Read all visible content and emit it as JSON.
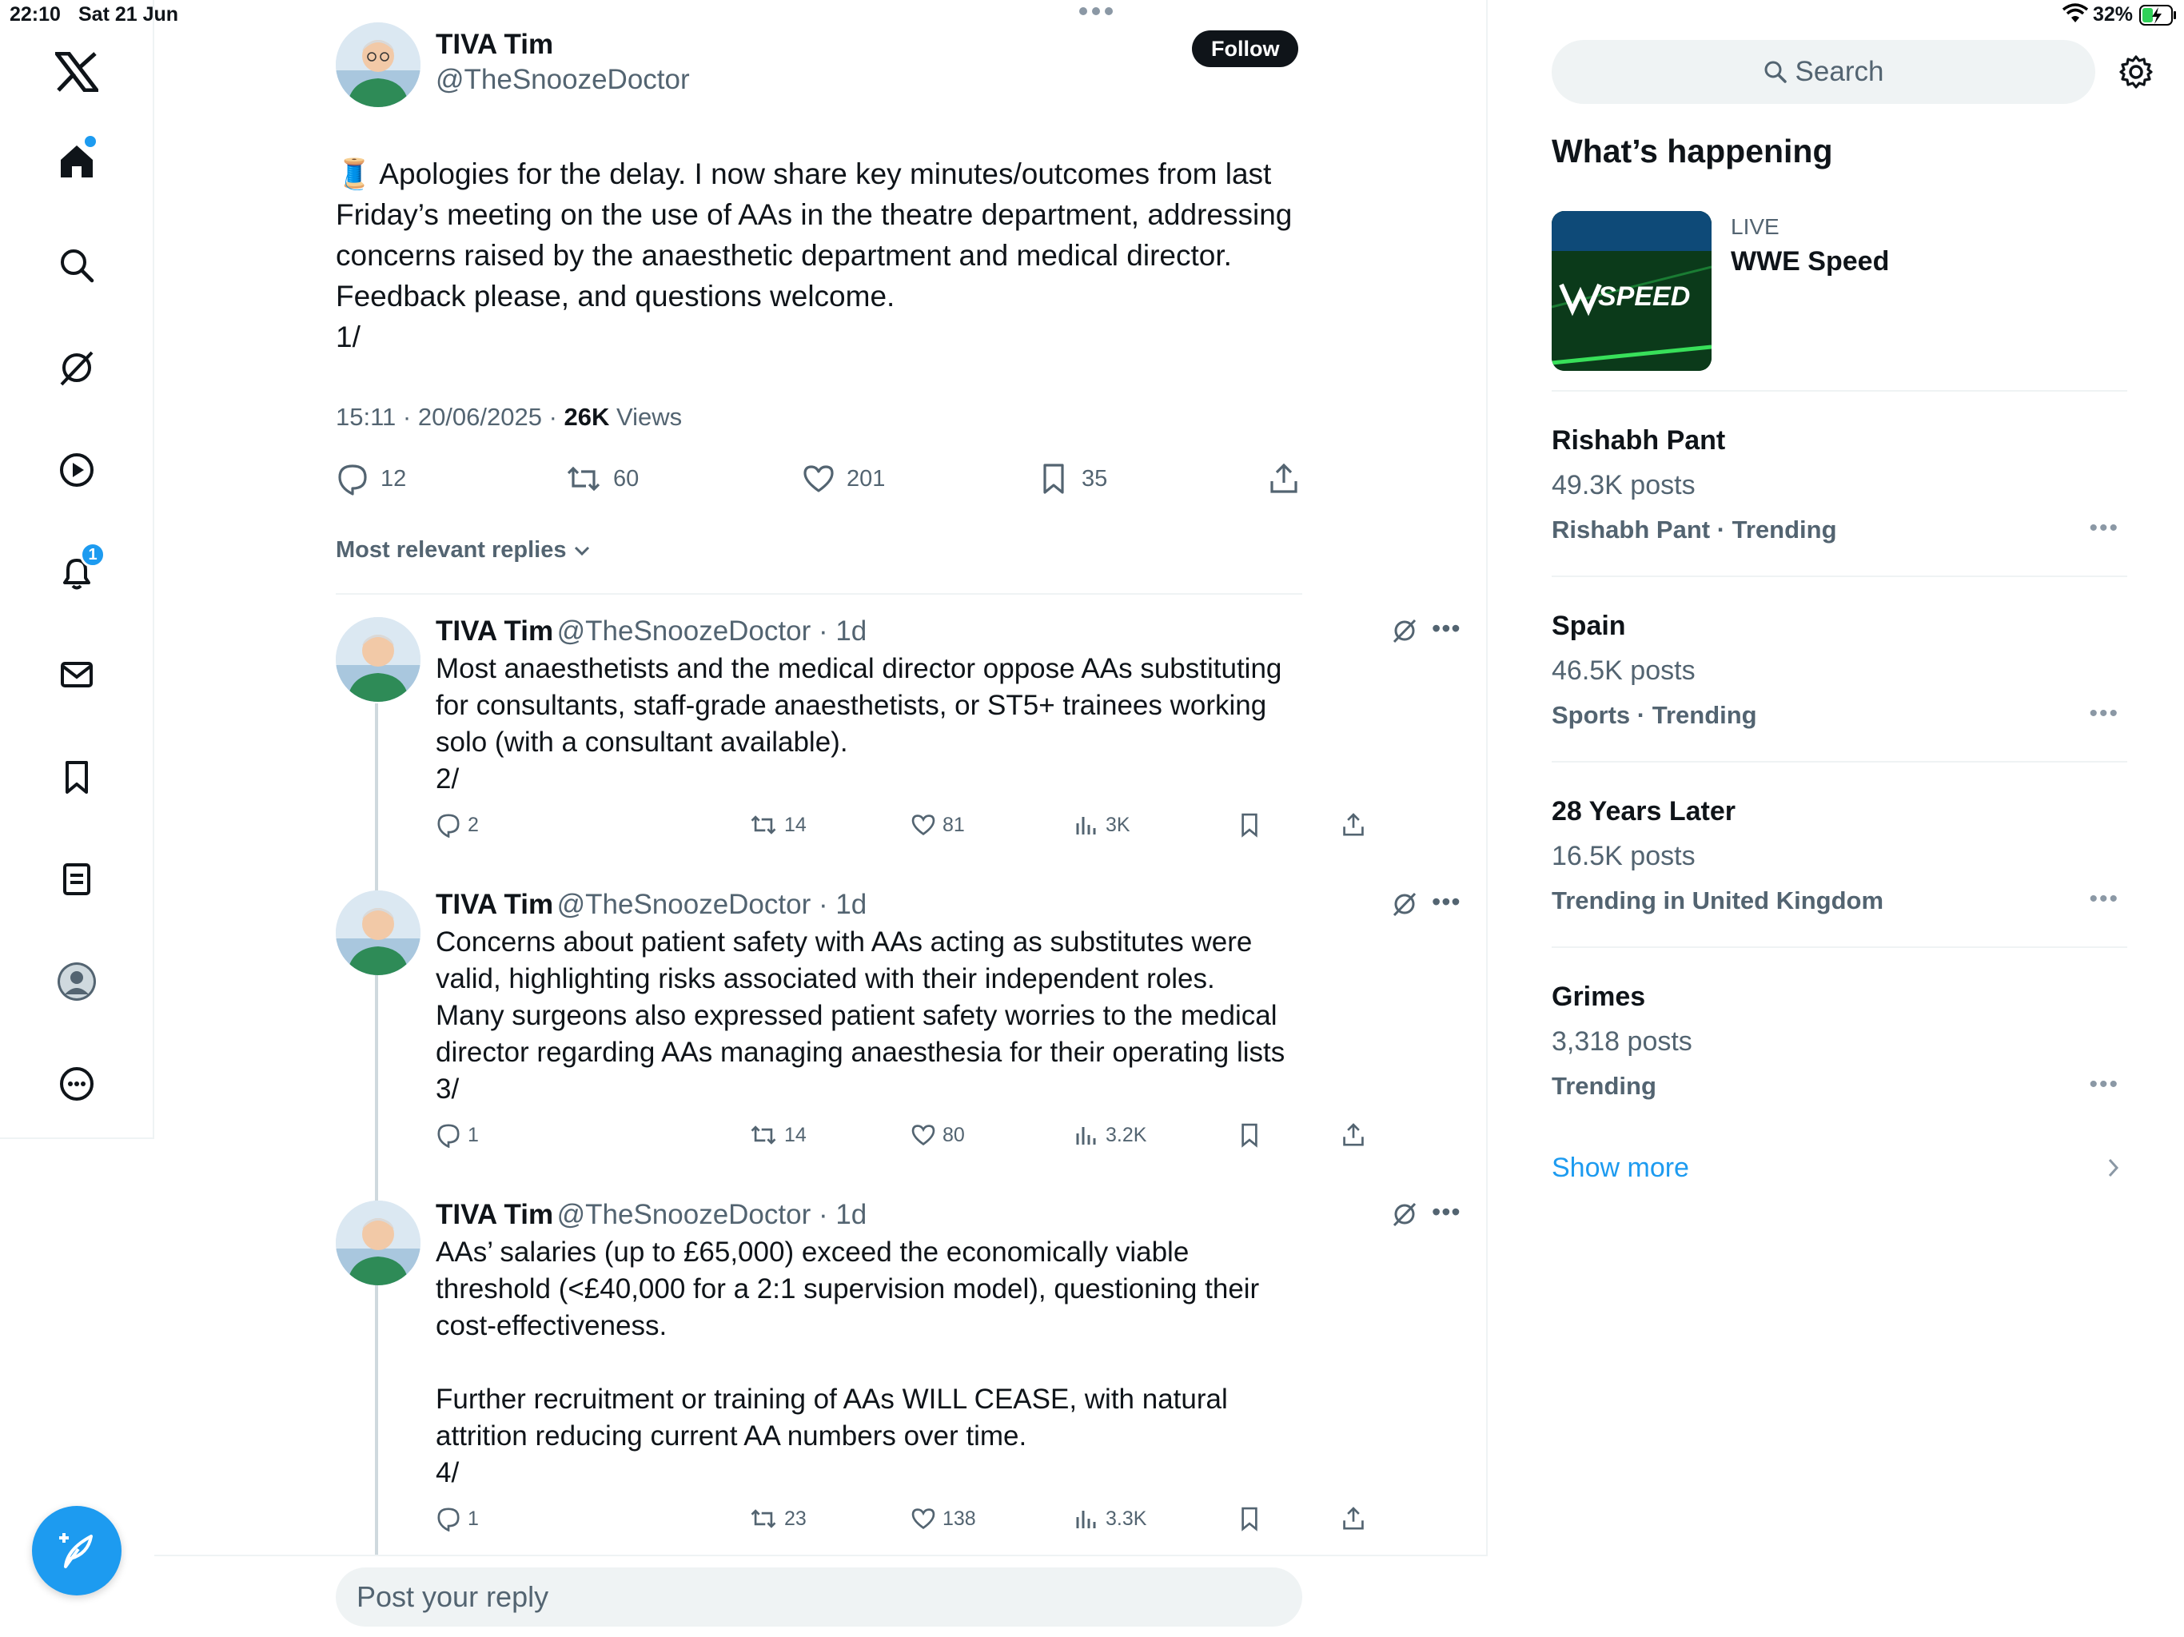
{
  "status": {
    "time": "22:10",
    "date": "Sat 21 Jun",
    "battery": "32%"
  },
  "nav": {
    "notifications_badge": "1"
  },
  "tweet": {
    "author": "TIVA Tim",
    "handle": "@TheSnoozeDoctor",
    "follow_label": "Follow",
    "body": "🧵 Apologies for the delay. I now share key minutes/outcomes from last Friday’s meeting on the use of AAs in the theatre department, addressing concerns raised by the anaesthetic department and medical director. Feedback please, and questions welcome.\n1/",
    "timestamp": "15:11 · 20/06/2025 · ",
    "views_count": "26K",
    "views_label": " Views",
    "replies": "12",
    "reposts": "60",
    "likes": "201",
    "bookmarks": "35"
  },
  "sort_label": "Most relevant replies",
  "replies": [
    {
      "name": "TIVA Tim",
      "handle": "@TheSnoozeDoctor · 1d",
      "text": "Most anaesthetists and the medical director oppose AAs substituting\nfor consultants, staff-grade anaesthetists, or ST5+ trainees working\nsolo (with a consultant available).\n2/",
      "replies": "2",
      "reposts": "14",
      "likes": "81",
      "views": "3K"
    },
    {
      "name": "TIVA Tim",
      "handle": "@TheSnoozeDoctor · 1d",
      "text": "Concerns about patient safety with AAs acting as substitutes were\nvalid, highlighting risks associated with their independent roles.\nMany surgeons also expressed patient safety worries to the medical\ndirector regarding AAs managing anaesthesia for their operating lists\n3/",
      "replies": "1",
      "reposts": "14",
      "likes": "80",
      "views": "3.2K"
    },
    {
      "name": "TIVA Tim",
      "handle": "@TheSnoozeDoctor · 1d",
      "text": "AAs’ salaries (up to £65,000) exceed the economically viable\nthreshold (<£40,000 for a 2:1 supervision model), questioning their\ncost-effectiveness.\n\nFurther recruitment or training of AAs WILL CEASE, with natural\nattrition reducing current AA numbers over time.\n4/",
      "replies": "1",
      "reposts": "23",
      "likes": "138",
      "views": "3.3K"
    }
  ],
  "reply_placeholder": "Post your reply",
  "sidebar": {
    "search_placeholder": "Search",
    "heading": "What’s happening",
    "live": {
      "label": "LIVE",
      "title": "WWE Speed",
      "logo_text": "SPEED"
    },
    "trends": [
      {
        "name": "Rishabh Pant",
        "count": "49.3K posts",
        "meta": "Rishabh Pant · Trending"
      },
      {
        "name": "Spain",
        "count": "46.5K posts",
        "meta": "Sports · Trending"
      },
      {
        "name": "28 Years Later",
        "count": "16.5K posts",
        "meta": "Trending in United Kingdom"
      },
      {
        "name": "Grimes",
        "count": "3,318 posts",
        "meta": "Trending"
      }
    ],
    "show_more": "Show more"
  },
  "colors": {
    "accent": "#1d9bf0",
    "secondary_text": "#536471",
    "divider": "#eff3f4"
  }
}
